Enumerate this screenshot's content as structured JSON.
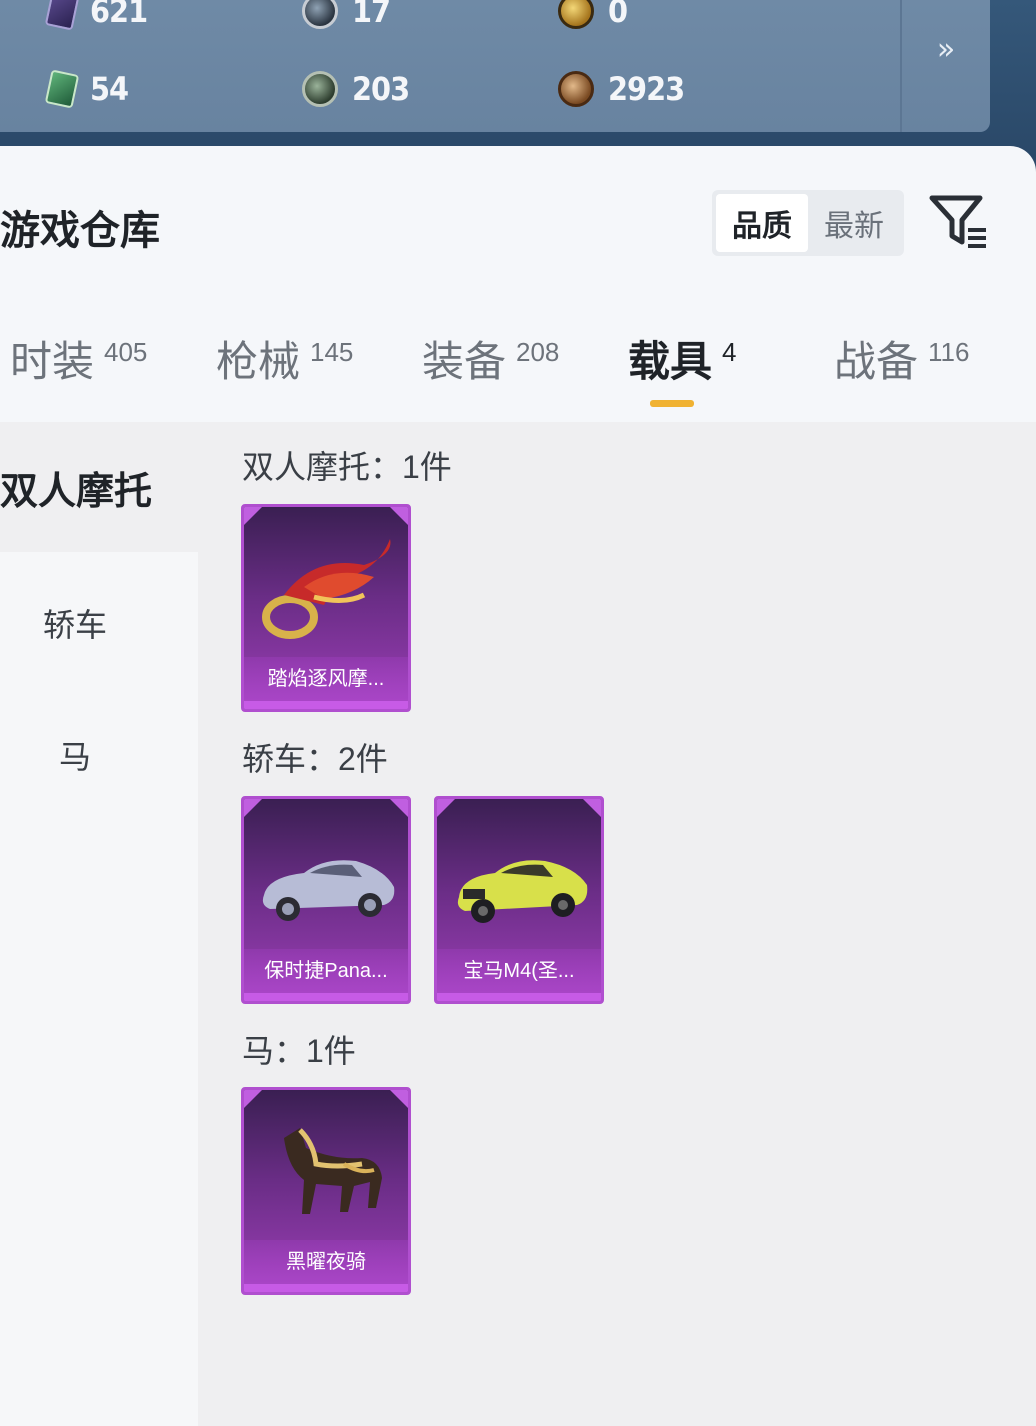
{
  "stats": {
    "row1": [
      {
        "icon": "purple-card-icon",
        "value": "621"
      },
      {
        "icon": "dark-coin-icon",
        "value": "17"
      },
      {
        "icon": "gold-coin-icon",
        "value": "0"
      }
    ],
    "row2": [
      {
        "icon": "green-card-icon",
        "value": "54"
      },
      {
        "icon": "green-coin-icon",
        "value": "203"
      },
      {
        "icon": "bronze-coin-icon",
        "value": "2923"
      }
    ],
    "more_icon": "»"
  },
  "header": {
    "title": "游戏仓库",
    "sort_options": [
      "品质",
      "最新"
    ],
    "sort_active": "品质"
  },
  "tabs": [
    {
      "label": "时装",
      "count": "405"
    },
    {
      "label": "枪械",
      "count": "145"
    },
    {
      "label": "装备",
      "count": "208"
    },
    {
      "label": "载具",
      "count": "4",
      "active": true
    },
    {
      "label": "战备",
      "count": "116"
    }
  ],
  "sidebar": {
    "selected": "双人摩托",
    "items": [
      "轿车",
      "马"
    ]
  },
  "groups": [
    {
      "title": "双人摩托：1件",
      "items": [
        {
          "name": "踏焰逐风摩...",
          "icon": "motorcycle-icon"
        }
      ]
    },
    {
      "title": "轿车：2件",
      "items": [
        {
          "name": "保时捷Pana...",
          "icon": "silver-car-icon"
        },
        {
          "name": "宝马M4(圣...",
          "icon": "yellow-car-icon"
        }
      ]
    },
    {
      "title": "马：1件",
      "items": [
        {
          "name": "黑曜夜骑",
          "icon": "horse-icon"
        }
      ]
    }
  ],
  "colors": {
    "accent": "#f0b232",
    "card_purple": "#9b3eb5"
  }
}
